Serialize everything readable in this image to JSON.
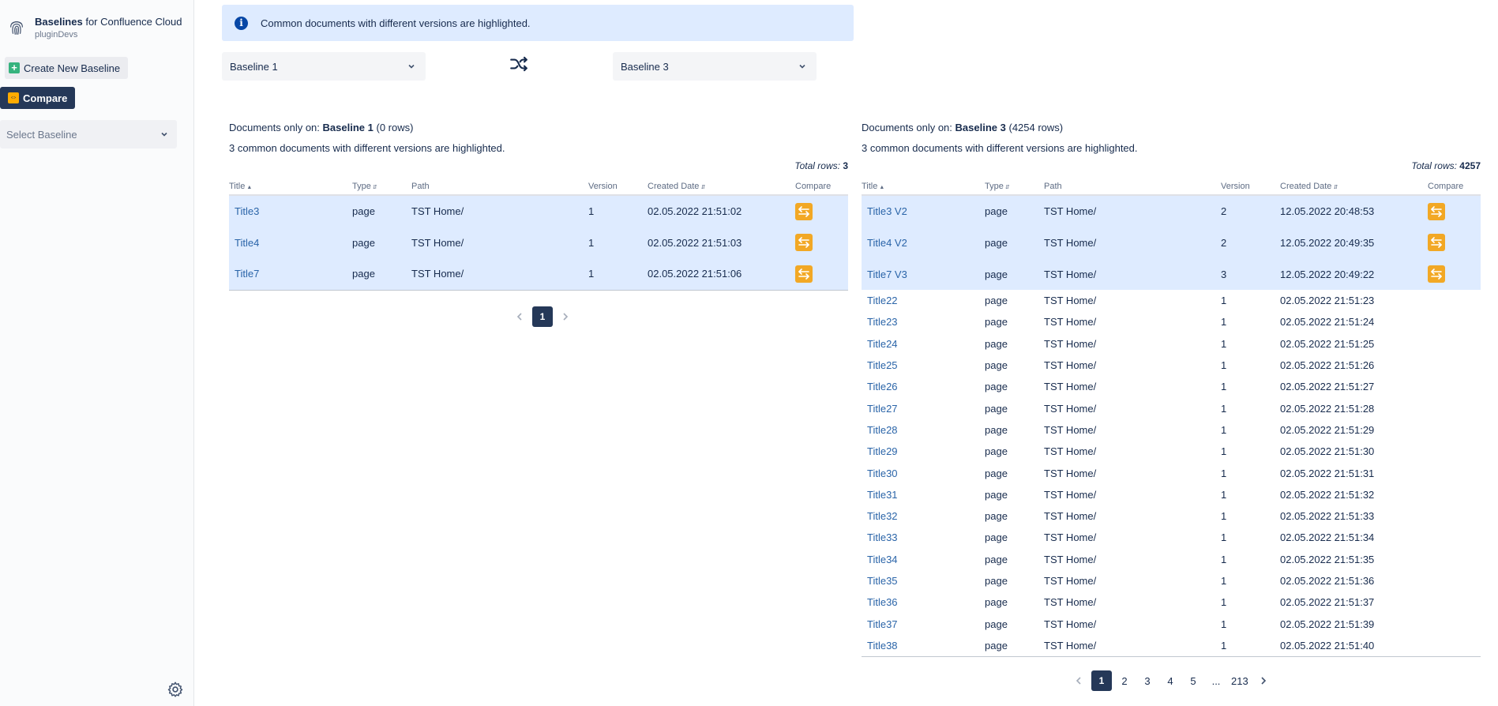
{
  "brand": {
    "title_bold": "Baselines",
    "title_rest": "for Confluence Cloud",
    "subtitle": "pluginDevs"
  },
  "sidebar": {
    "create_label": "Create New Baseline",
    "compare_label": "Compare",
    "select_placeholder": "Select Baseline"
  },
  "banner": {
    "text": "Common documents with different versions are highlighted."
  },
  "selectors": {
    "left": "Baseline 1",
    "right": "Baseline 3"
  },
  "columns": {
    "title": "Title",
    "type": "Type",
    "path": "Path",
    "version": "Version",
    "created": "Created Date",
    "compare": "Compare"
  },
  "left_panel": {
    "head_prefix": "Documents only on:",
    "baseline": "Baseline 1",
    "rows_note": "(0 rows)",
    "note": "3 common documents with different versions are highlighted.",
    "total_label": "Total rows:",
    "total": "3",
    "rows": [
      {
        "title": "Title3",
        "type": "page",
        "path": "TST Home/",
        "version": "1",
        "created": "02.05.2022 21:51:02"
      },
      {
        "title": "Title4",
        "type": "page",
        "path": "TST Home/",
        "version": "1",
        "created": "02.05.2022 21:51:03"
      },
      {
        "title": "Title7",
        "type": "page",
        "path": "TST Home/",
        "version": "1",
        "created": "02.05.2022 21:51:06"
      }
    ],
    "pages": [
      "1"
    ]
  },
  "right_panel": {
    "head_prefix": "Documents only on:",
    "baseline": "Baseline 3",
    "rows_note": "(4254 rows)",
    "note": "3 common documents with different versions are highlighted.",
    "total_label": "Total rows:",
    "total": "4257",
    "highlighted": [
      {
        "title": "Title3 V2",
        "type": "page",
        "path": "TST Home/",
        "version": "2",
        "created": "12.05.2022 20:48:53"
      },
      {
        "title": "Title4 V2",
        "type": "page",
        "path": "TST Home/",
        "version": "2",
        "created": "12.05.2022 20:49:35"
      },
      {
        "title": "Title7 V3",
        "type": "page",
        "path": "TST Home/",
        "version": "3",
        "created": "12.05.2022 20:49:22"
      }
    ],
    "rows": [
      {
        "title": "Title22",
        "type": "page",
        "path": "TST Home/",
        "version": "1",
        "created": "02.05.2022 21:51:23"
      },
      {
        "title": "Title23",
        "type": "page",
        "path": "TST Home/",
        "version": "1",
        "created": "02.05.2022 21:51:24"
      },
      {
        "title": "Title24",
        "type": "page",
        "path": "TST Home/",
        "version": "1",
        "created": "02.05.2022 21:51:25"
      },
      {
        "title": "Title25",
        "type": "page",
        "path": "TST Home/",
        "version": "1",
        "created": "02.05.2022 21:51:26"
      },
      {
        "title": "Title26",
        "type": "page",
        "path": "TST Home/",
        "version": "1",
        "created": "02.05.2022 21:51:27"
      },
      {
        "title": "Title27",
        "type": "page",
        "path": "TST Home/",
        "version": "1",
        "created": "02.05.2022 21:51:28"
      },
      {
        "title": "Title28",
        "type": "page",
        "path": "TST Home/",
        "version": "1",
        "created": "02.05.2022 21:51:29"
      },
      {
        "title": "Title29",
        "type": "page",
        "path": "TST Home/",
        "version": "1",
        "created": "02.05.2022 21:51:30"
      },
      {
        "title": "Title30",
        "type": "page",
        "path": "TST Home/",
        "version": "1",
        "created": "02.05.2022 21:51:31"
      },
      {
        "title": "Title31",
        "type": "page",
        "path": "TST Home/",
        "version": "1",
        "created": "02.05.2022 21:51:32"
      },
      {
        "title": "Title32",
        "type": "page",
        "path": "TST Home/",
        "version": "1",
        "created": "02.05.2022 21:51:33"
      },
      {
        "title": "Title33",
        "type": "page",
        "path": "TST Home/",
        "version": "1",
        "created": "02.05.2022 21:51:34"
      },
      {
        "title": "Title34",
        "type": "page",
        "path": "TST Home/",
        "version": "1",
        "created": "02.05.2022 21:51:35"
      },
      {
        "title": "Title35",
        "type": "page",
        "path": "TST Home/",
        "version": "1",
        "created": "02.05.2022 21:51:36"
      },
      {
        "title": "Title36",
        "type": "page",
        "path": "TST Home/",
        "version": "1",
        "created": "02.05.2022 21:51:37"
      },
      {
        "title": "Title37",
        "type": "page",
        "path": "TST Home/",
        "version": "1",
        "created": "02.05.2022 21:51:39"
      },
      {
        "title": "Title38",
        "type": "page",
        "path": "TST Home/",
        "version": "1",
        "created": "02.05.2022 21:51:40"
      }
    ],
    "pages": [
      "1",
      "2",
      "3",
      "4",
      "5",
      "...",
      "213"
    ]
  }
}
